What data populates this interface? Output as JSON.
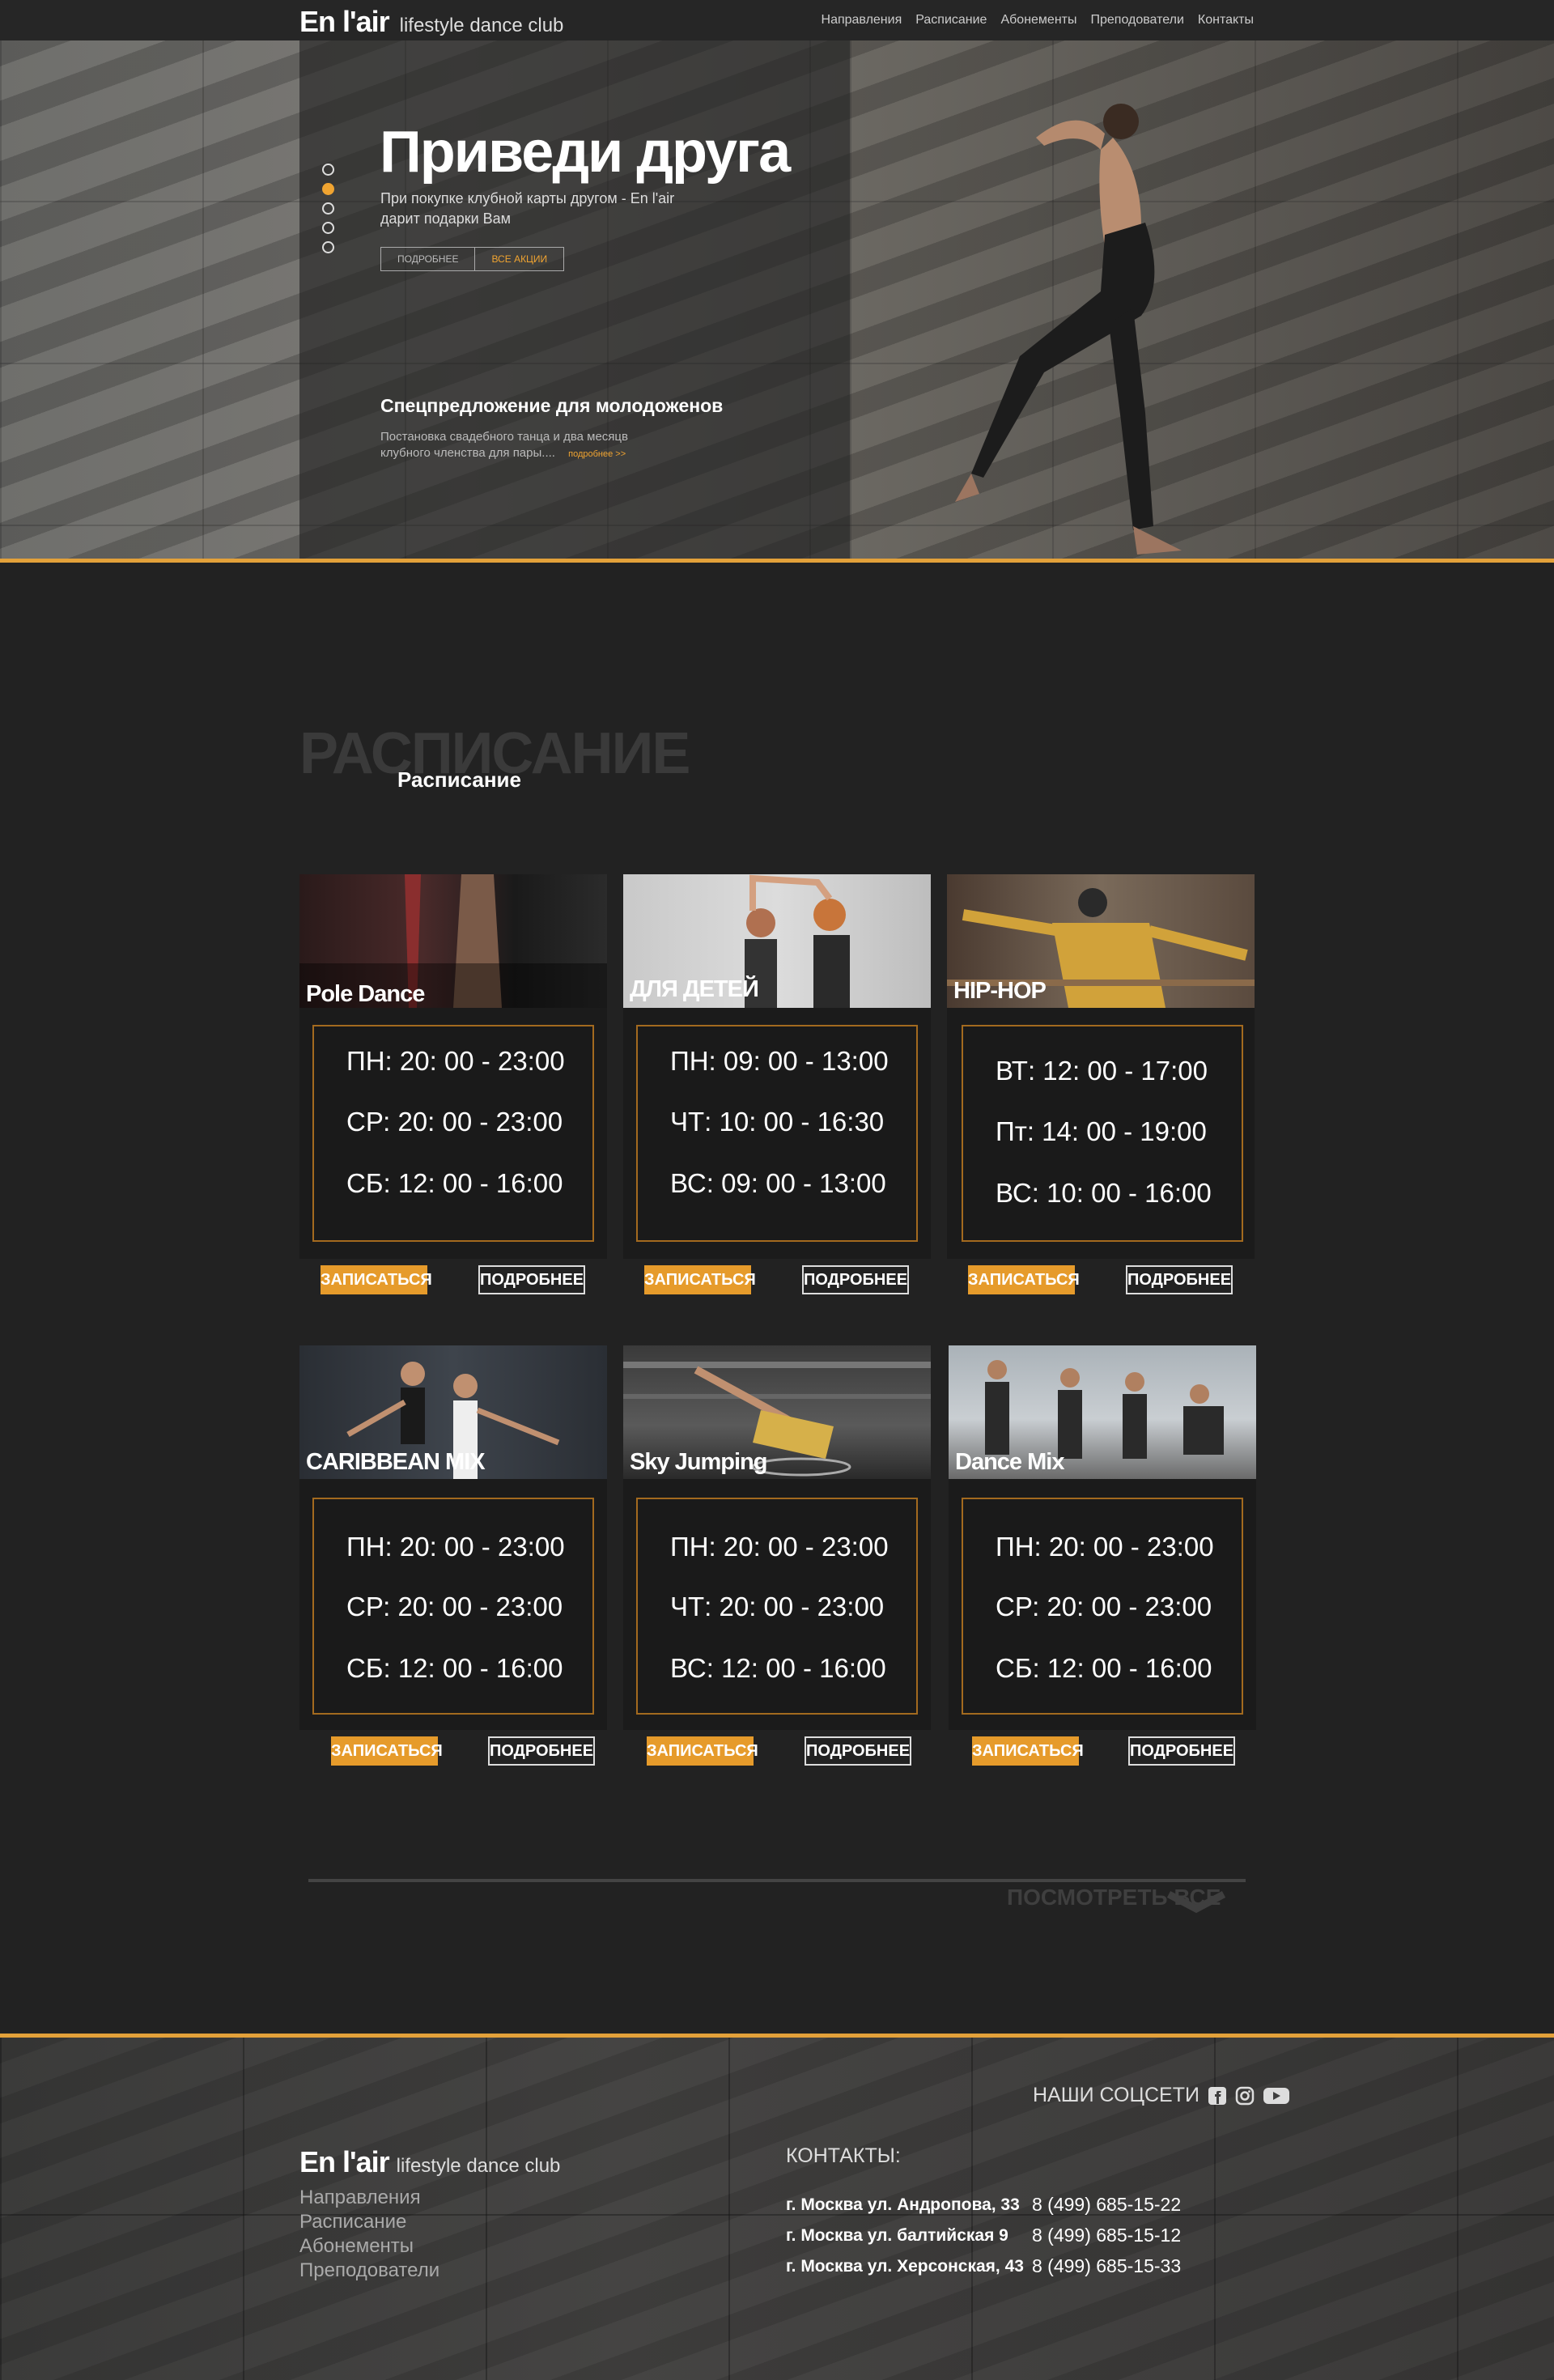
{
  "header": {
    "logo": "En l'air",
    "logo_sub": "lifestyle dance club",
    "nav": [
      "Направления",
      "Расписание",
      "Абонементы",
      "Преподователи",
      "Контакты"
    ]
  },
  "hero": {
    "title": "Приведи друга",
    "text": "При покупке клубной карты другом - En l'air дарит подарки Вам",
    "btn_more": "ПОДРОБНЕЕ",
    "btn_all": "ВСЕ АКЦИИ",
    "offer_title": "Спецпредложение для молодоженов",
    "offer_text": "Постановка свадебного танца и два месяцв клубного членства для пары....",
    "offer_link": "подробнее >>"
  },
  "schedule": {
    "bg_title": "РАСПИСАНИЕ",
    "title": "Расписание",
    "sign_label": "ЗАПИСАТЬСЯ",
    "more_label": "ПОДРОБНЕЕ",
    "cards": [
      {
        "name": "Pole Dance",
        "rows": [
          "ПН:  20: 00 - 23:00",
          "СР:  20: 00 - 23:00",
          "СБ:  12: 00 - 16:00"
        ]
      },
      {
        "name": "ДЛЯ ДЕТЕЙ",
        "rows": [
          "ПН:  09: 00 - 13:00",
          "ЧТ:  10: 00 - 16:30",
          "ВС:  09: 00 - 13:00"
        ]
      },
      {
        "name": "HIP-HOP",
        "rows": [
          "ВТ:  12: 00 - 17:00",
          "Пт:  14: 00 - 19:00",
          "ВС:  10: 00 - 16:00"
        ]
      },
      {
        "name": "CARIBBEAN MIX",
        "rows": [
          "ПН:  20: 00 - 23:00",
          "СР:  20: 00 - 23:00",
          "СБ:  12: 00 - 16:00"
        ]
      },
      {
        "name": "Sky Jumping",
        "rows": [
          "ПН:  20: 00 - 23:00",
          "ЧТ:  20: 00 - 23:00",
          "ВС:  12: 00 - 16:00"
        ]
      },
      {
        "name": "Dance Mix",
        "rows": [
          "ПН:  20: 00 - 23:00",
          "СР:  20: 00 - 23:00",
          "СБ:  12: 00 - 16:00"
        ]
      }
    ],
    "see_all": "ПОСМОТРЕТЬ ВСЕ"
  },
  "footer": {
    "social_label": "НАШИ СОЦСЕТИ",
    "logo": "En l'air",
    "logo_sub": "lifestyle dance club",
    "links": [
      "Направления",
      "Расписание",
      "Абонементы",
      "Преподователи"
    ],
    "contacts_title": "КОНТАКТЫ:",
    "contacts": [
      {
        "address": "г. Москва ул. Андропова, 33",
        "phone": "8  (499)  685-15-22"
      },
      {
        "address": "г. Москва ул. балтийская 9",
        "phone": "8  (499)  685-15-12"
      },
      {
        "address": "г. Москва ул.  Херсонская, 43",
        "phone": "8  (499)  685-15-33"
      }
    ]
  },
  "colors": {
    "accent": "#e69b2b",
    "background": "#222222",
    "card": "#1b1b1b"
  }
}
